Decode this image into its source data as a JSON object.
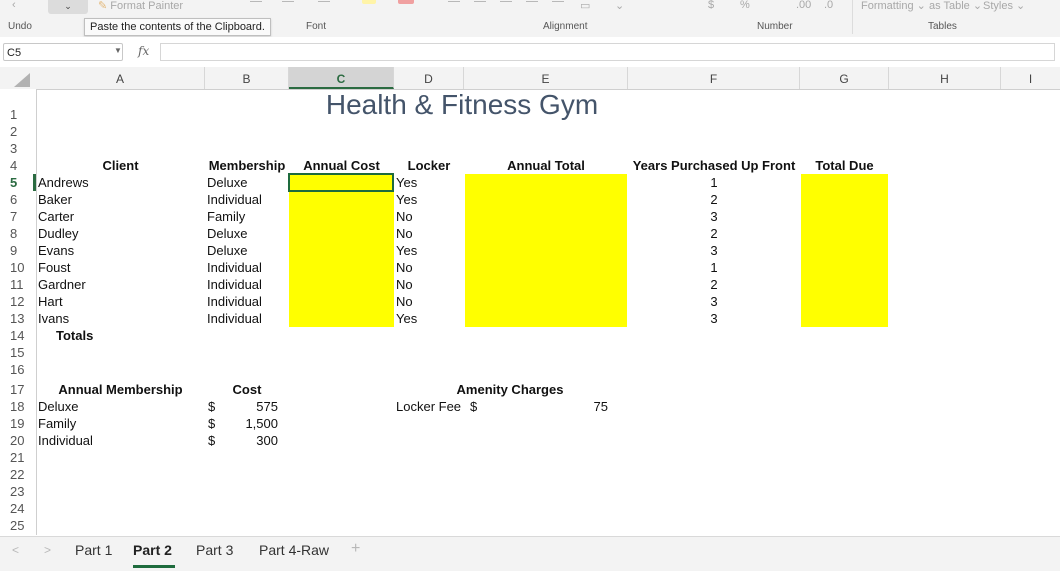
{
  "ribbon": {
    "format_painter": "Format Painter",
    "tooltip": "Paste the contents of the Clipboard.",
    "groups": {
      "undo": "Undo",
      "font": "Font",
      "alignment": "Alignment",
      "number": "Number",
      "tables": "Tables"
    },
    "formatting": "Formatting",
    "as_table": "as Table",
    "styles": "Styles"
  },
  "formula_bar": {
    "name_box": "C5",
    "fx": "fx",
    "formula": ""
  },
  "columns": [
    "A",
    "B",
    "C",
    "D",
    "E",
    "F",
    "G",
    "H",
    "I"
  ],
  "selected_column": "C",
  "rows": [
    "1",
    "2",
    "3",
    "4",
    "5",
    "6",
    "7",
    "8",
    "9",
    "10",
    "11",
    "12",
    "13",
    "14",
    "15",
    "16",
    "17",
    "18",
    "19",
    "20",
    "21",
    "22",
    "23",
    "24",
    "25"
  ],
  "selected_row": "5",
  "sheet": {
    "title": "Health & Fitness Gym",
    "headers": {
      "client": "Client",
      "membership": "Membership",
      "annual_cost": "Annual Cost",
      "locker": "Locker",
      "annual_total": "Annual Total",
      "years": "Years Purchased Up Front",
      "total_due": "Total Due"
    },
    "clients": [
      {
        "name": "Andrews",
        "membership": "Deluxe",
        "locker": "Yes",
        "years": "1"
      },
      {
        "name": "Baker",
        "membership": "Individual",
        "locker": "Yes",
        "years": "2"
      },
      {
        "name": "Carter",
        "membership": "Family",
        "locker": "No",
        "years": "3"
      },
      {
        "name": "Dudley",
        "membership": "Deluxe",
        "locker": "No",
        "years": "2"
      },
      {
        "name": "Evans",
        "membership": "Deluxe",
        "locker": "Yes",
        "years": "3"
      },
      {
        "name": "Foust",
        "membership": "Individual",
        "locker": "No",
        "years": "1"
      },
      {
        "name": "Gardner",
        "membership": "Individual",
        "locker": "No",
        "years": "2"
      },
      {
        "name": "Hart",
        "membership": "Individual",
        "locker": "No",
        "years": "3"
      },
      {
        "name": "Ivans",
        "membership": "Individual",
        "locker": "Yes",
        "years": "3"
      }
    ],
    "totals_label": "Totals",
    "membership_table": {
      "header": "Annual Membership",
      "cost_header": "Cost",
      "currency": "$",
      "rows": [
        {
          "name": "Deluxe",
          "cost": "575"
        },
        {
          "name": "Family",
          "cost": "1,500"
        },
        {
          "name": "Individual",
          "cost": "300"
        }
      ]
    },
    "amenity": {
      "header": "Amenity Charges",
      "label": "Locker Fee",
      "currency": "$",
      "value": "75"
    },
    "highlight_color": "#ffff00",
    "accent_color": "#1e6b3d"
  },
  "tabs": [
    "Part 1",
    "Part 2",
    "Part 3",
    "Part 4-Raw"
  ],
  "active_tab": "Part 2"
}
